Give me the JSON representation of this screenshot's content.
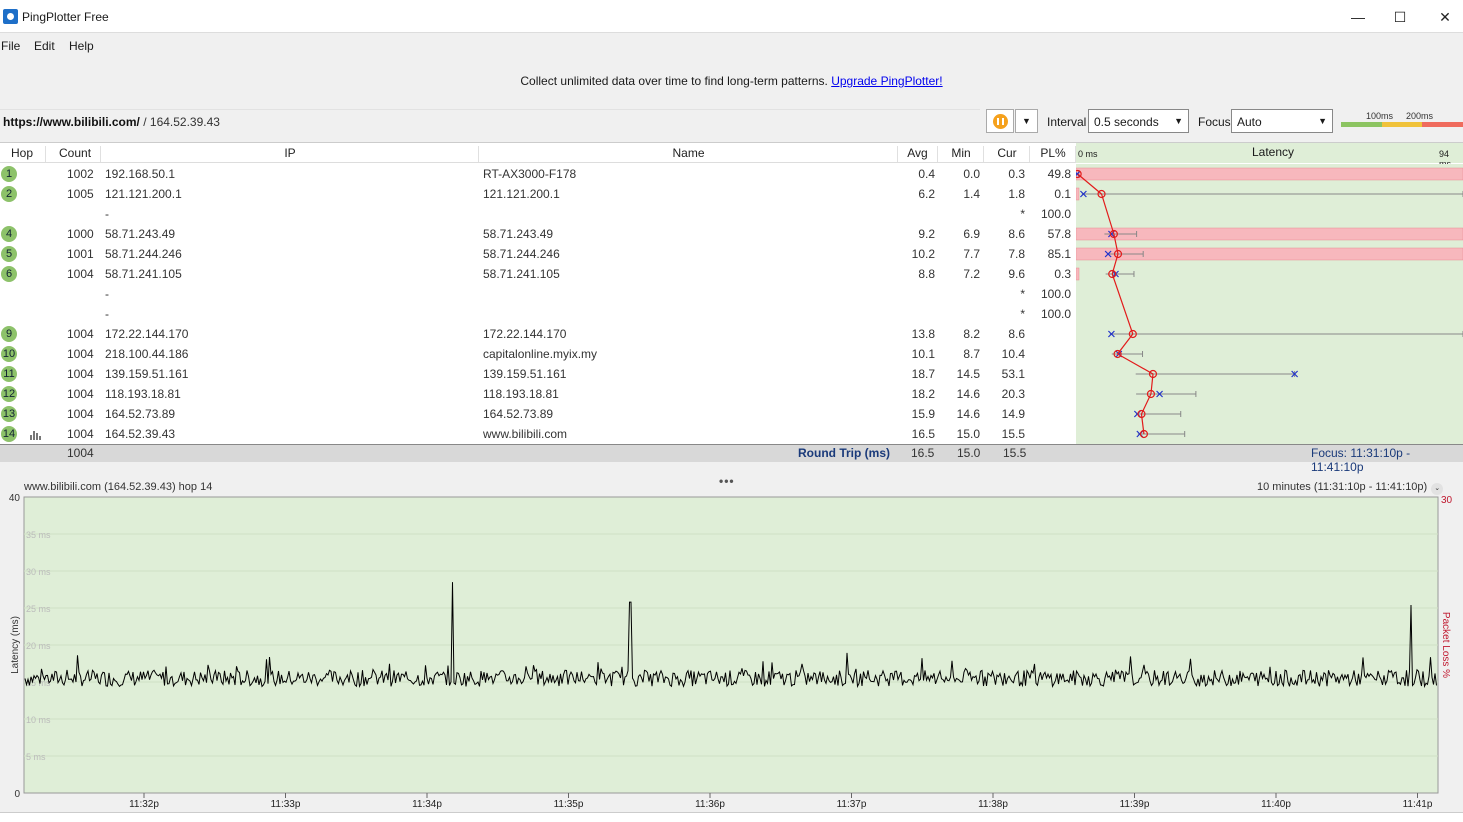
{
  "window": {
    "title": "PingPlotter Free",
    "minimize": "—",
    "maximize": "☐",
    "close": "✕"
  },
  "menu": [
    "File",
    "Edit",
    "Help"
  ],
  "banner": {
    "text": "Collect unlimited data over time to find long-term patterns.",
    "link": "Upgrade PingPlotter!"
  },
  "target": {
    "host": "https://www.bilibili.com/",
    "ip": " / 164.52.39.43"
  },
  "interval": {
    "label": "Interval",
    "value": "0.5 seconds"
  },
  "focus": {
    "label": "Focus",
    "value": "Auto"
  },
  "scale_legend": {
    "t1": "100ms",
    "t2": "200ms",
    "colors": [
      "#8cc461",
      "#f0c23a",
      "#ef6b5d"
    ]
  },
  "columns": {
    "hop": "Hop",
    "count": "Count",
    "ip": "IP",
    "name": "Name",
    "avg": "Avg",
    "min": "Min",
    "cur": "Cur",
    "pl": "PL%",
    "latency": "Latency",
    "lat_min": "0 ms",
    "lat_max": "94 ms"
  },
  "hops": [
    {
      "hop": "1",
      "count": "1002",
      "ip": "192.168.50.1",
      "name": "RT-AX3000-F178",
      "avg": "0.4",
      "min": "0.0",
      "cur": "0.3",
      "pl": "49.8"
    },
    {
      "hop": "2",
      "count": "1005",
      "ip": "121.121.200.1",
      "name": "121.121.200.1",
      "avg": "6.2",
      "min": "1.4",
      "cur": "1.8",
      "pl": "0.1"
    },
    {
      "hop": "",
      "count": "",
      "ip": "-",
      "name": "",
      "avg": "",
      "min": "",
      "cur": "*",
      "pl": "100.0"
    },
    {
      "hop": "4",
      "count": "1000",
      "ip": "58.71.243.49",
      "name": "58.71.243.49",
      "avg": "9.2",
      "min": "6.9",
      "cur": "8.6",
      "pl": "57.8"
    },
    {
      "hop": "5",
      "count": "1001",
      "ip": "58.71.244.246",
      "name": "58.71.244.246",
      "avg": "10.2",
      "min": "7.7",
      "cur": "7.8",
      "pl": "85.1"
    },
    {
      "hop": "6",
      "count": "1004",
      "ip": "58.71.241.105",
      "name": "58.71.241.105",
      "avg": "8.8",
      "min": "7.2",
      "cur": "9.6",
      "pl": "0.3"
    },
    {
      "hop": "",
      "count": "",
      "ip": "-",
      "name": "",
      "avg": "",
      "min": "",
      "cur": "*",
      "pl": "100.0"
    },
    {
      "hop": "",
      "count": "",
      "ip": "-",
      "name": "",
      "avg": "",
      "min": "",
      "cur": "*",
      "pl": "100.0"
    },
    {
      "hop": "9",
      "count": "1004",
      "ip": "172.22.144.170",
      "name": "172.22.144.170",
      "avg": "13.8",
      "min": "8.2",
      "cur": "8.6",
      "pl": ""
    },
    {
      "hop": "10",
      "count": "1004",
      "ip": "218.100.44.186",
      "name": "capitalonline.myix.my",
      "avg": "10.1",
      "min": "8.7",
      "cur": "10.4",
      "pl": ""
    },
    {
      "hop": "11",
      "count": "1004",
      "ip": "139.159.51.161",
      "name": "139.159.51.161",
      "avg": "18.7",
      "min": "14.5",
      "cur": "53.1",
      "pl": ""
    },
    {
      "hop": "12",
      "count": "1004",
      "ip": "118.193.18.81",
      "name": "118.193.18.81",
      "avg": "18.2",
      "min": "14.6",
      "cur": "20.3",
      "pl": ""
    },
    {
      "hop": "13",
      "count": "1004",
      "ip": "164.52.73.89",
      "name": "164.52.73.89",
      "avg": "15.9",
      "min": "14.6",
      "cur": "14.9",
      "pl": ""
    },
    {
      "hop": "14",
      "count": "1004",
      "ip": "164.52.39.43",
      "name": "www.bilibili.com",
      "avg": "16.5",
      "min": "15.0",
      "cur": "15.5",
      "pl": ""
    }
  ],
  "summary": {
    "count": "1004",
    "label": "Round Trip (ms)",
    "avg": "16.5",
    "min": "15.0",
    "cur": "15.5",
    "focus": "Focus: 11:31:10p - 11:41:10p"
  },
  "timeline": {
    "title": "www.bilibili.com (164.52.39.43) hop 14",
    "range": "10 minutes (11:31:10p - 11:41:10p)",
    "chev": "⌄"
  },
  "chart_data": {
    "type": "line",
    "title": "www.bilibili.com (164.52.39.43) hop 14",
    "ylabel": "Latency (ms)",
    "y2label": "Packet Loss %",
    "ylim": [
      0,
      40
    ],
    "y2max": "30",
    "ytick_labels": [
      "40",
      "35 ms",
      "30 ms",
      "25 ms",
      "20 ms",
      "15 ms",
      "10 ms",
      "5 ms",
      "0"
    ],
    "xtick_labels": [
      "11:32p",
      "11:33p",
      "11:34p",
      "11:35p",
      "11:36p",
      "11:37p",
      "11:38p",
      "11:39p",
      "11:40p",
      "11:41p"
    ],
    "baseline_ms": 15.5,
    "spikes": [
      {
        "time": "11:34p",
        "value": 28.5
      },
      {
        "time": "11:35p",
        "value": 25.8
      },
      {
        "time": "11:41p",
        "value": 25.4
      }
    ],
    "background": "#dfeed7",
    "line_color": "#000000"
  },
  "latency_graph": {
    "axis_max_ms": 94,
    "avg_ms": [
      0.4,
      6.2,
      null,
      9.2,
      10.2,
      8.8,
      null,
      null,
      13.8,
      10.1,
      18.7,
      18.2,
      15.9,
      16.5
    ],
    "min_ms": [
      0.0,
      1.4,
      null,
      6.9,
      7.7,
      7.2,
      null,
      null,
      8.2,
      8.7,
      14.5,
      14.6,
      14.6,
      15.0
    ],
    "cur_ms": [
      0.3,
      1.8,
      null,
      8.6,
      7.8,
      9.6,
      null,
      null,
      8.6,
      10.4,
      53.1,
      20.3,
      14.9,
      15.5
    ],
    "pl": [
      49.8,
      0.1,
      100.0,
      57.8,
      85.1,
      0.3,
      100.0,
      100.0,
      0,
      0,
      0,
      0,
      0,
      0
    ]
  }
}
